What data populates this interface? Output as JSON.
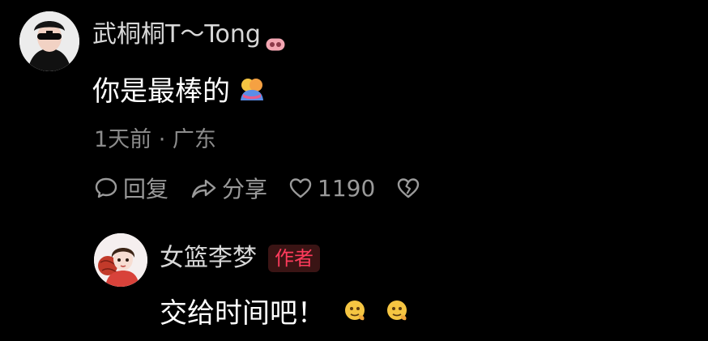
{
  "comment": {
    "username": "武桐桐T～Tong",
    "text": "你是最棒的",
    "meta": "1天前 · 广东",
    "actions": {
      "reply_label": "回复",
      "share_label": "分享",
      "like_count": "1190"
    }
  },
  "reply": {
    "username": "女篮李梦",
    "badge": "作者",
    "text": "交给时间吧！"
  },
  "colors": {
    "background": "#000000",
    "username": "#d8d8d8",
    "meta": "#8c8c8c",
    "badge_text": "#ff3b5c",
    "badge_bg": "#3a1414"
  },
  "icons": {
    "user_badge": "pig-icon",
    "comment_emoji": "hug-emoji-icon",
    "reply_emojis": [
      "face-emoji-icon",
      "face-emoji-icon"
    ],
    "reply": "speech-bubble-icon",
    "share": "share-arrow-icon",
    "like": "heart-icon",
    "dislike": "broken-heart-icon"
  }
}
